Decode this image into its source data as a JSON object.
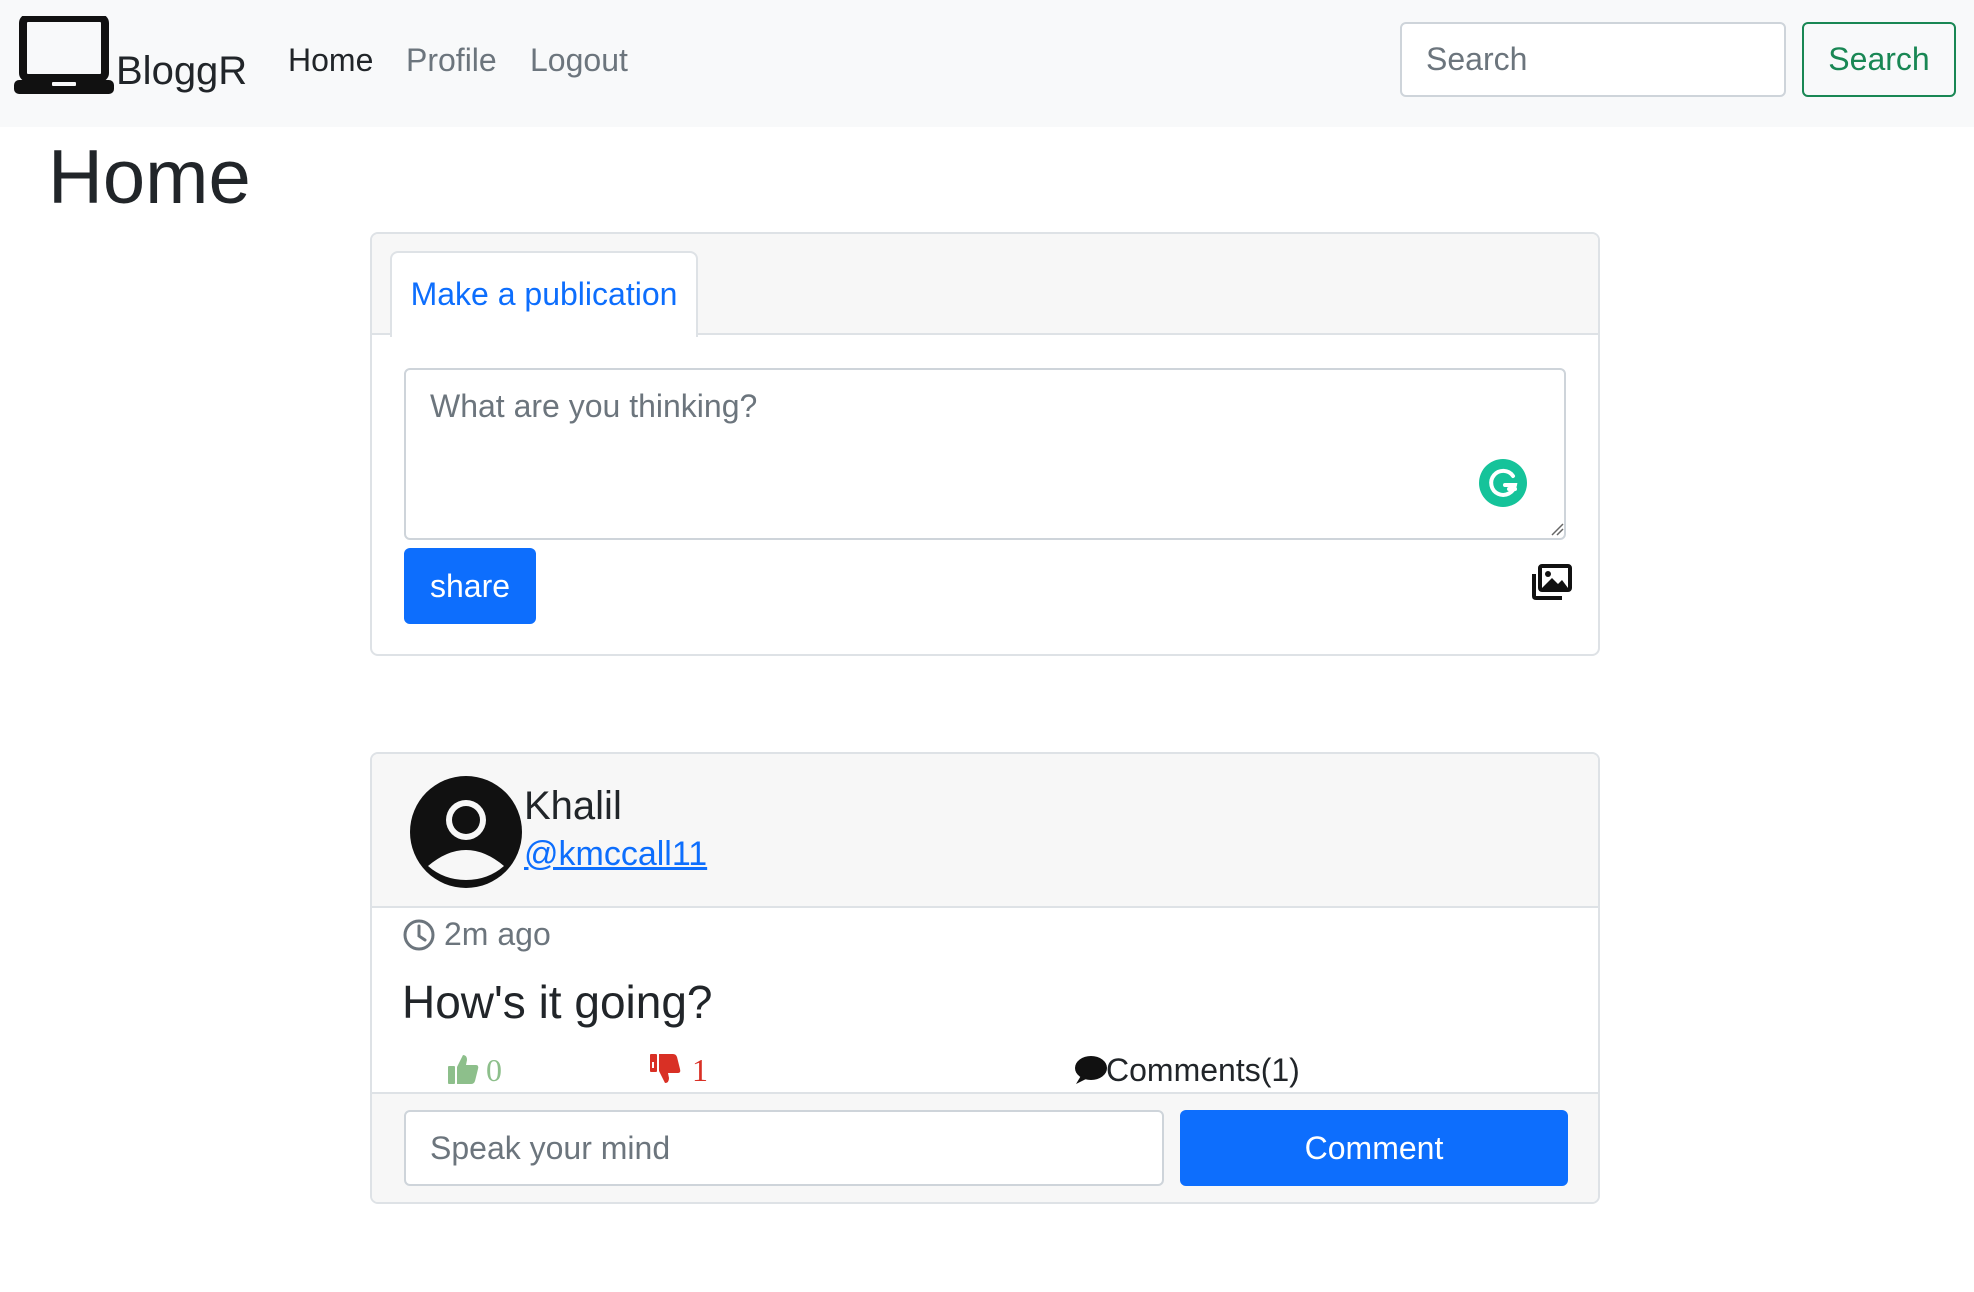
{
  "navbar": {
    "brand": "BloggR",
    "brand_icon": "laptop-icon",
    "links": [
      {
        "label": "Home",
        "active": true
      },
      {
        "label": "Profile",
        "active": false
      },
      {
        "label": "Logout",
        "active": false
      }
    ],
    "search": {
      "placeholder": "Search",
      "value": "",
      "button_label": "Search",
      "button_color": "#198754"
    }
  },
  "page": {
    "title": "Home"
  },
  "publication": {
    "tab_label": "Make a publication",
    "textarea_placeholder": "What are you thinking?",
    "textarea_value": "",
    "share_label": "share",
    "icons": [
      "grammarly-icon",
      "images-icon"
    ],
    "accent_color": "#0d6efd"
  },
  "post": {
    "author_name": "Khalil",
    "author_handle": "@kmccall11",
    "time": "2m ago",
    "text": "How's it going?",
    "likes": "0",
    "dislikes": "1",
    "comments_label": "Comments(1)",
    "comment_placeholder": "Speak your mind",
    "comment_value": "",
    "comment_button_label": "Comment",
    "icons": [
      "avatar-icon",
      "clock-icon",
      "thumbs-up-icon",
      "thumbs-down-icon",
      "comment-bubble-icon"
    ],
    "like_color": "#8dbf8b",
    "dislike_color": "#d93025"
  }
}
